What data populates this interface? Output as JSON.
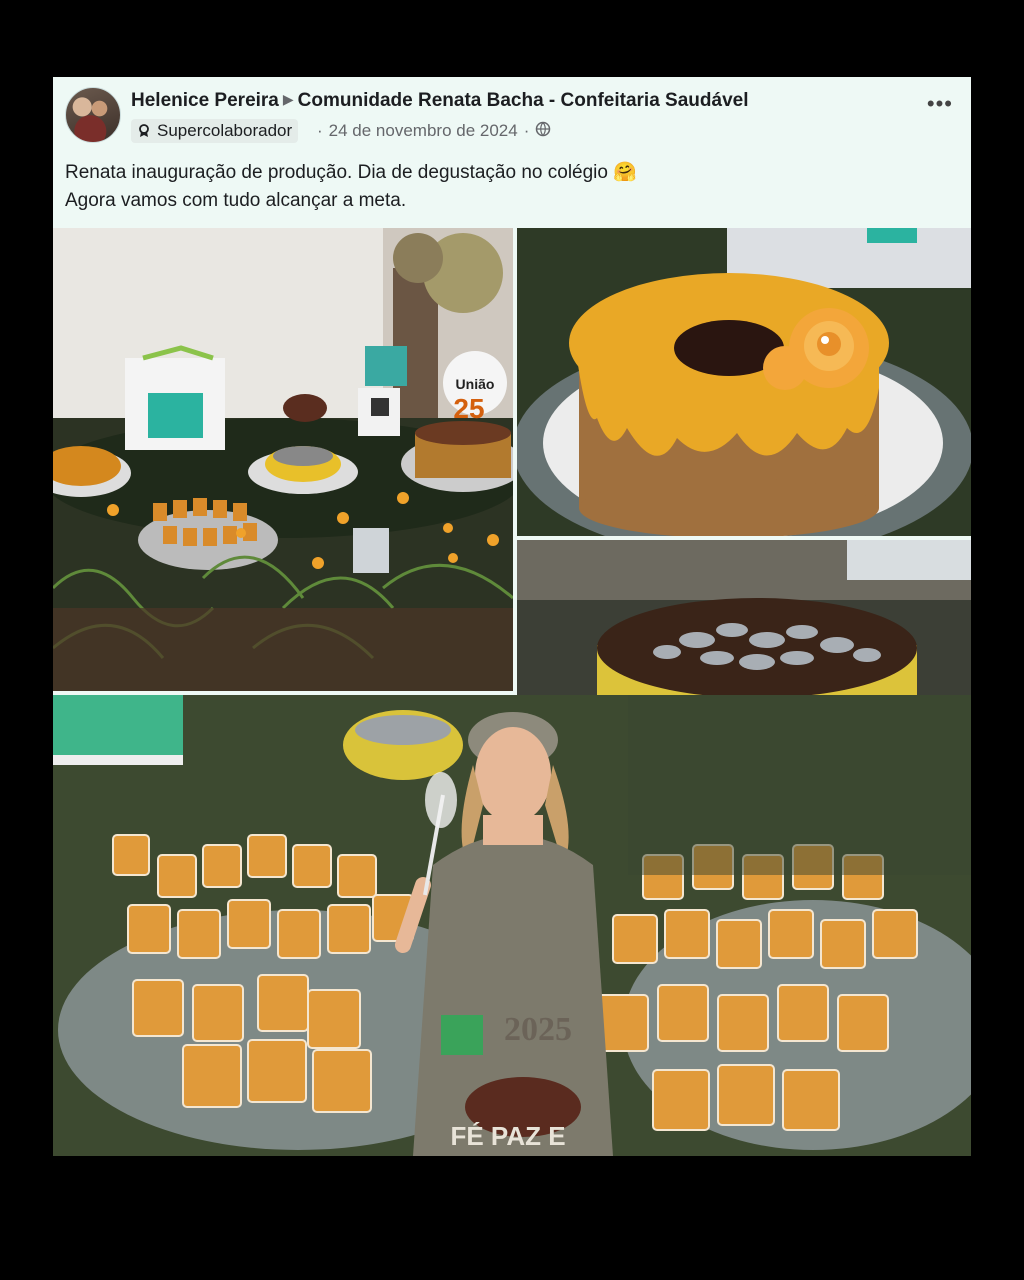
{
  "post": {
    "author": "Helenice Pereira",
    "group": "Comunidade Renata Bacha - Confeitaria Saudável",
    "badge": "Supercolaborador",
    "date": "24 de novembro de 2024",
    "text_line1": "Renata inauguração de produção. Dia de degustação no colégio 🤗",
    "text_line2": "Agora vamos com tudo alcançar a meta.",
    "more_label": "•••",
    "privacy_icon": "globe-icon"
  },
  "photos": {
    "count": 4,
    "subjects": [
      "dessert-table",
      "glazed-cake",
      "chocolate-cake",
      "baker-with-desserts"
    ],
    "sign_text": "União",
    "sign_number": "25",
    "topper_year": "2025",
    "topper_text": "FÉ PAZ E"
  },
  "colors": {
    "card_bg": "#eef9f5",
    "page_bg": "#000000",
    "text": "#1c1e21",
    "secondary_text": "#65676b"
  }
}
